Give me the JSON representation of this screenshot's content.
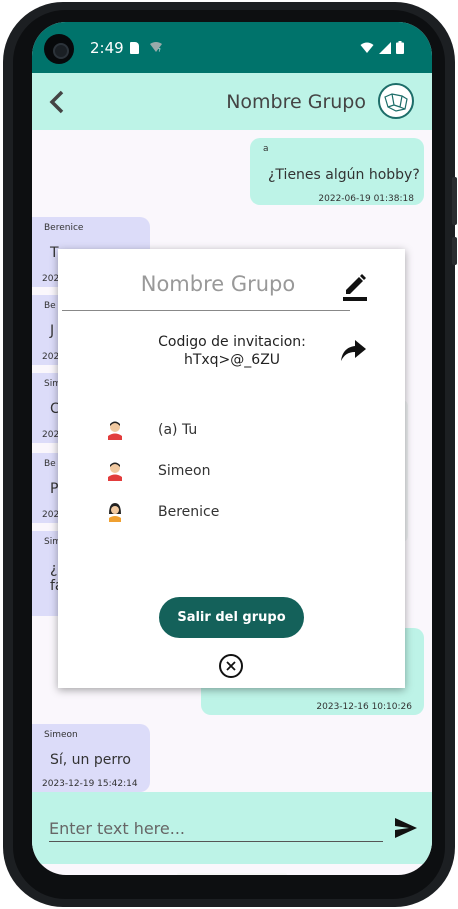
{
  "status": {
    "time": "2:49",
    "wifi_badge": "?"
  },
  "appbar": {
    "title": "Nombre Grupo"
  },
  "messages": [
    {
      "side": "right",
      "sender": "a",
      "text": "¿Tienes algún hobby?",
      "time": "2022-06-19 01:38:18"
    },
    {
      "side": "left",
      "sender": "Berenice",
      "text": "T...",
      "time": "202"
    },
    {
      "side": "left",
      "sender": "Be",
      "text": "J",
      "time": "202"
    },
    {
      "side": "left",
      "sender": "Sim",
      "text": "C",
      "time": "202"
    },
    {
      "side": "left",
      "sender": "Be",
      "text": "P",
      "time": "202"
    },
    {
      "side": "left",
      "sender": "Simeo",
      "text": "¿",
      "text2": "fa"
    },
    {
      "side": "right",
      "time": "2023-12-16 10:10:26"
    },
    {
      "side": "left",
      "sender": "Simeon",
      "text": "Sí, un perro",
      "time": "2023-12-19 15:42:14"
    }
  ],
  "input": {
    "placeholder": "Enter text here..."
  },
  "dialog": {
    "title": "Nombre Grupo",
    "invite_label": "Codigo de invitacion:",
    "invite_code": "hTxq>@_6ZU",
    "members": [
      {
        "name": "(a) Tu",
        "icon": "male-avatar-icon"
      },
      {
        "name": "Simeon",
        "icon": "male-avatar-icon"
      },
      {
        "name": "Berenice",
        "icon": "female-avatar-icon"
      }
    ],
    "leave_label": "Salir del grupo"
  },
  "colors": {
    "primary": "#00736b",
    "accent_light": "#bdf3e7",
    "bubble_other": "#dcdcf9",
    "button": "#14615a"
  }
}
